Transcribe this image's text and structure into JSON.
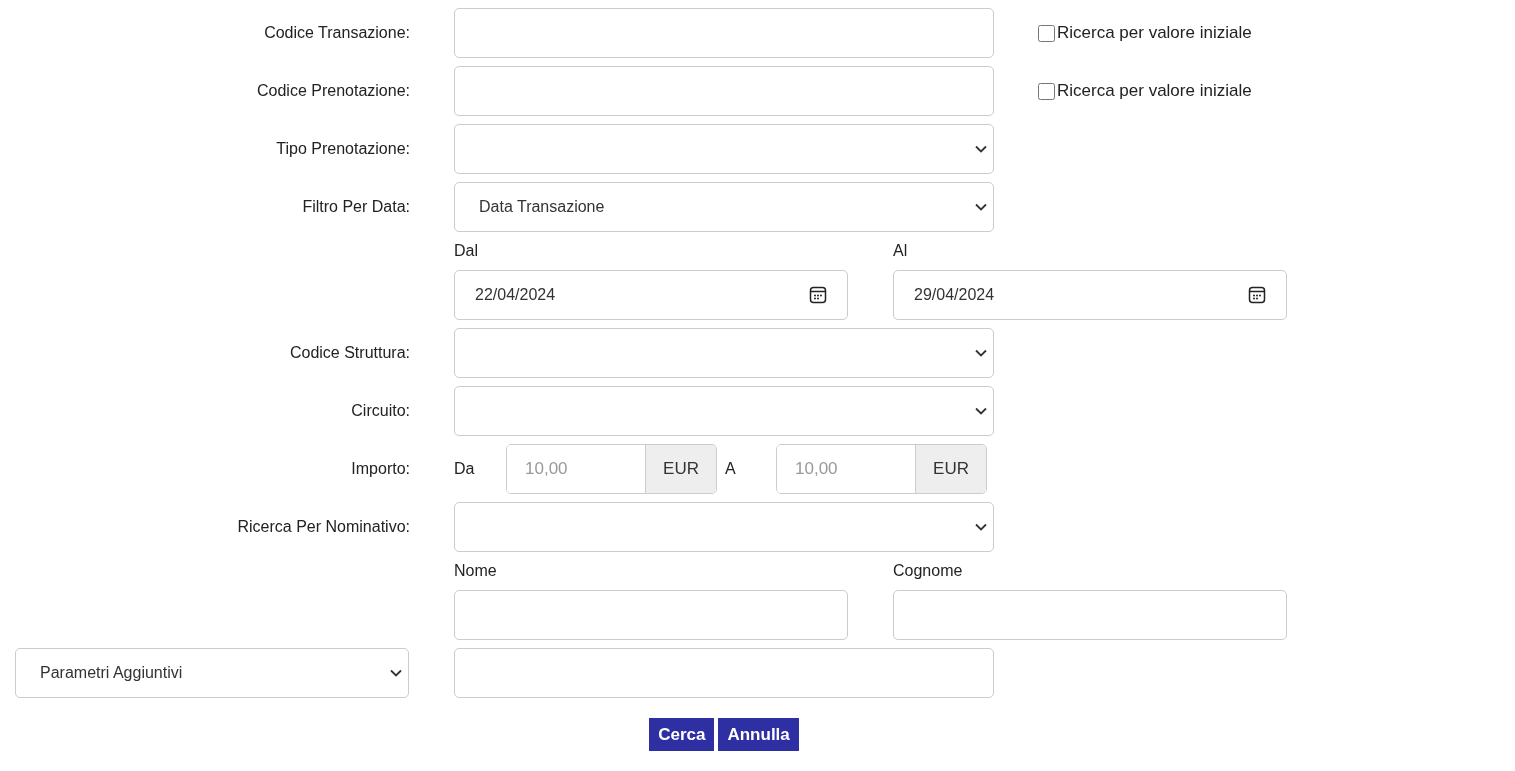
{
  "rows": [
    {
      "kind": "text",
      "label": "Codice Transazione:",
      "checkbox": {
        "label": "Ricerca per valore iniziale",
        "checked": false
      }
    },
    {
      "kind": "text",
      "label": "Codice Prenotazione:",
      "checkbox": {
        "label": "Ricerca per valore iniziale",
        "checked": false
      }
    },
    {
      "kind": "select",
      "label": "Tipo Prenotazione:"
    },
    {
      "kind": "select",
      "label": "Filtro Per Data:",
      "value": "Data Transazione"
    },
    {
      "kind": "dates",
      "fields": [
        {
          "label": "Dal",
          "value": "22/04/2024"
        },
        {
          "label": "Al",
          "value": "29/04/2024"
        }
      ]
    },
    {
      "kind": "select",
      "label": "Codice Struttura:"
    },
    {
      "kind": "select",
      "label": "Circuito:"
    },
    {
      "kind": "amount",
      "label": "Importo:",
      "from": {
        "prefix": "Da",
        "placeholder": "10,00",
        "unit": "EUR"
      },
      "to": {
        "prefix": "A",
        "placeholder": "10,00",
        "unit": "EUR"
      }
    },
    {
      "kind": "select",
      "label": "Ricerca Per Nominativo:"
    },
    {
      "kind": "pair",
      "fields": [
        {
          "label": "Nome"
        },
        {
          "label": "Cognome"
        }
      ]
    },
    {
      "kind": "extra",
      "select": "Parametri Aggiuntivi"
    }
  ],
  "buttons": [
    "Cerca",
    "Annulla"
  ]
}
